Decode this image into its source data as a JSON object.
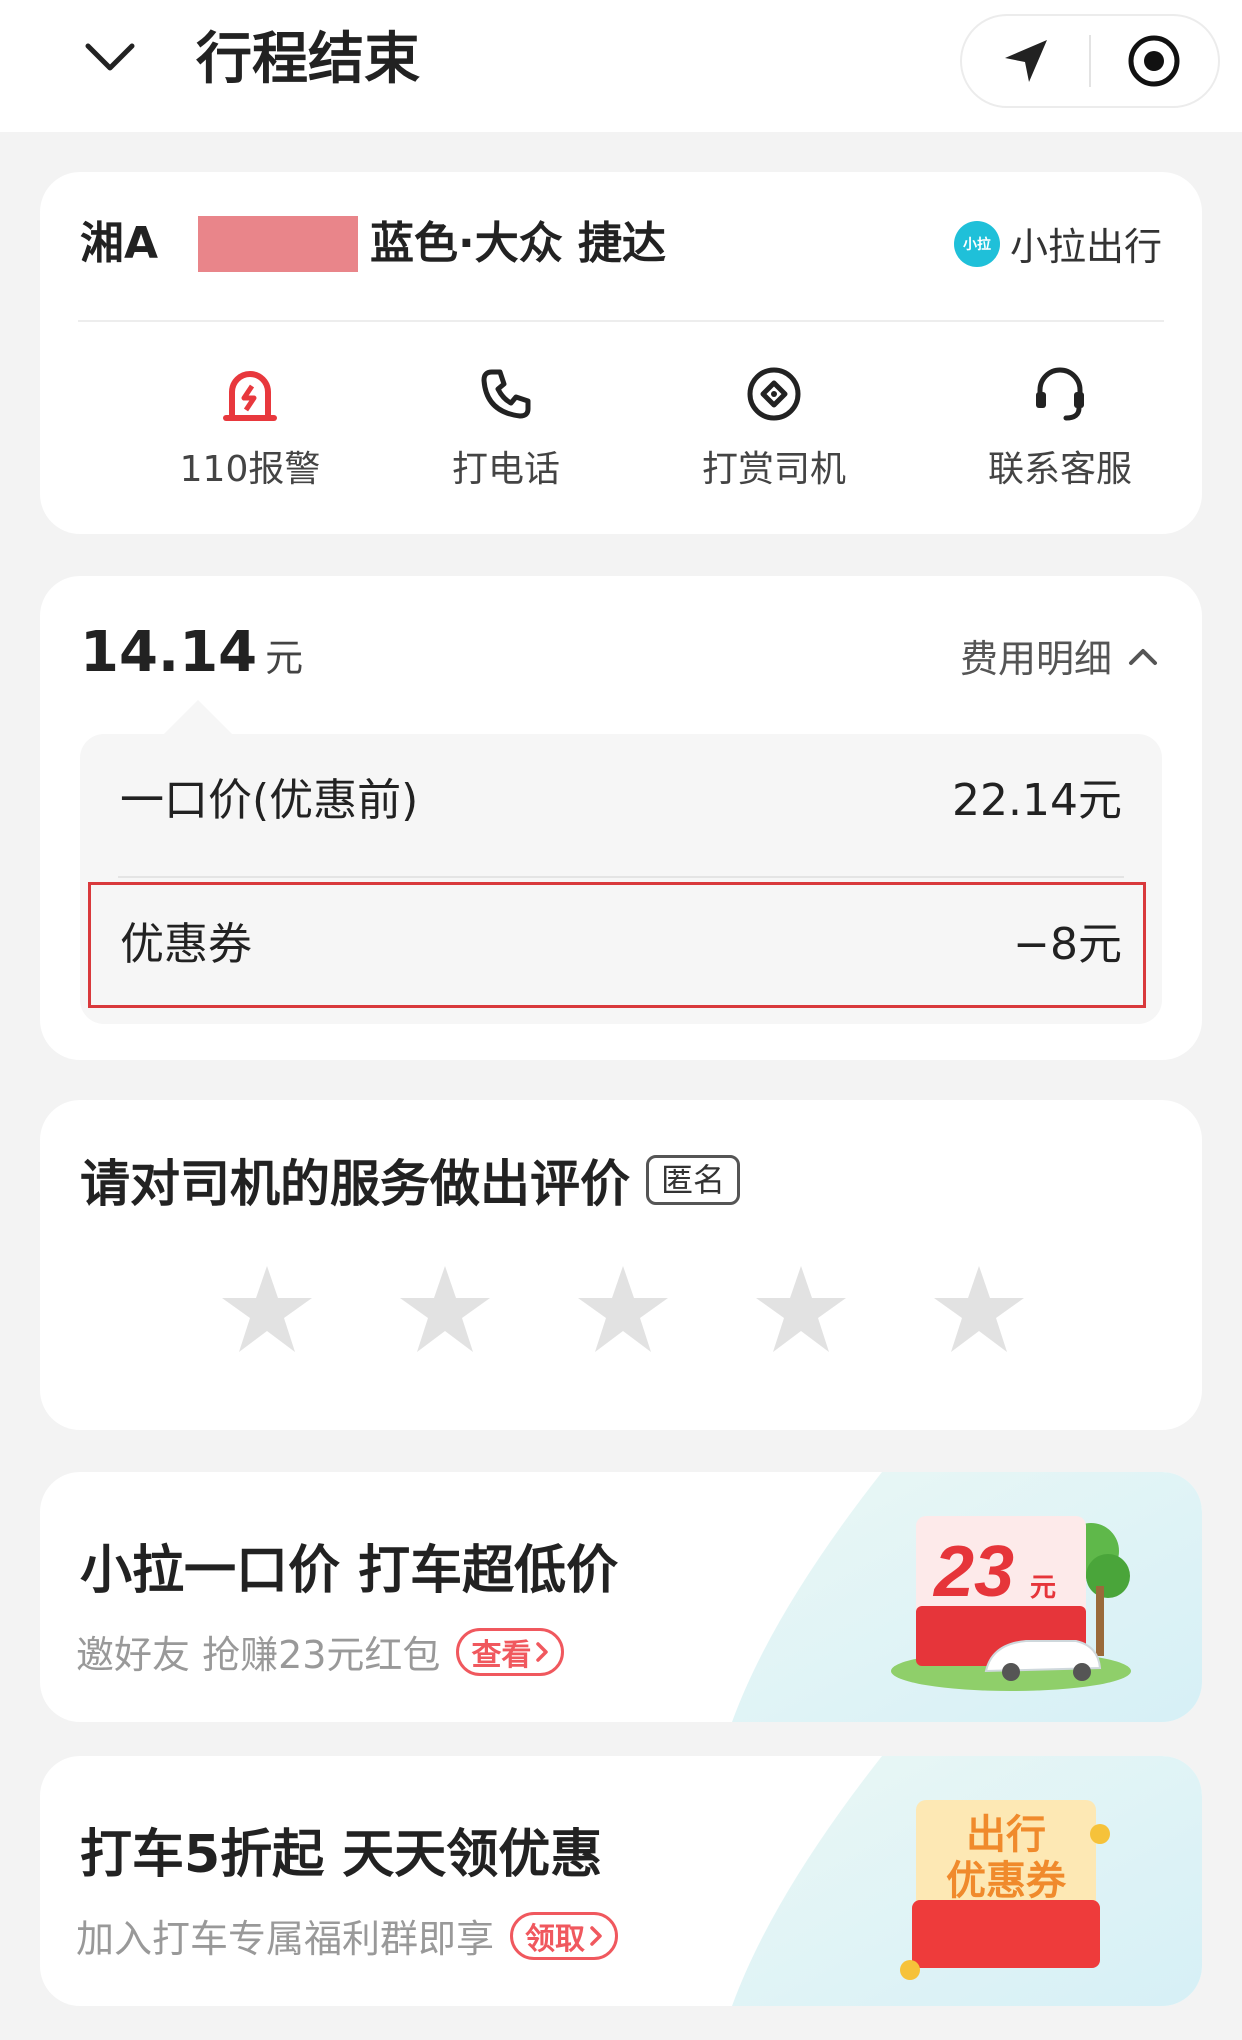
{
  "header": {
    "title": "行程结束"
  },
  "car": {
    "plate_prefix": "湘A",
    "description": "蓝色·大众 捷达",
    "brand_logo_text": "小拉",
    "brand_name": "小拉出行",
    "actions": [
      {
        "label": "110报警",
        "icon": "alarm-icon"
      },
      {
        "label": "打电话",
        "icon": "phone-icon"
      },
      {
        "label": "打赏司机",
        "icon": "reward-icon"
      },
      {
        "label": "联系客服",
        "icon": "headset-icon"
      }
    ]
  },
  "fee": {
    "total": "14.14",
    "unit": "元",
    "detail_label": "费用明细",
    "rows": [
      {
        "key": "一口价(优惠前)",
        "value": "22.14元"
      },
      {
        "key": "优惠券",
        "value": "−8元"
      }
    ]
  },
  "rating": {
    "title": "请对司机的服务做出评价",
    "badge": "匿名",
    "stars": 5,
    "star_color": "#e2e2e2"
  },
  "promos": [
    {
      "title": "小拉一口价 打车超低价",
      "subtitle": "邀好友 抢赚23元红包",
      "button": "查看",
      "image_text": "23",
      "image_unit": "元"
    },
    {
      "title": "打车5折起 天天领优惠",
      "subtitle": "加入打车专属福利群即享",
      "button": "领取",
      "image_line1": "出行",
      "image_line2": "优惠券"
    }
  ],
  "colors": {
    "accent_red": "#f0585e",
    "alarm_red": "#e8383d",
    "brand_teal": "#1fc0d9",
    "highlight": "#d9393c"
  }
}
